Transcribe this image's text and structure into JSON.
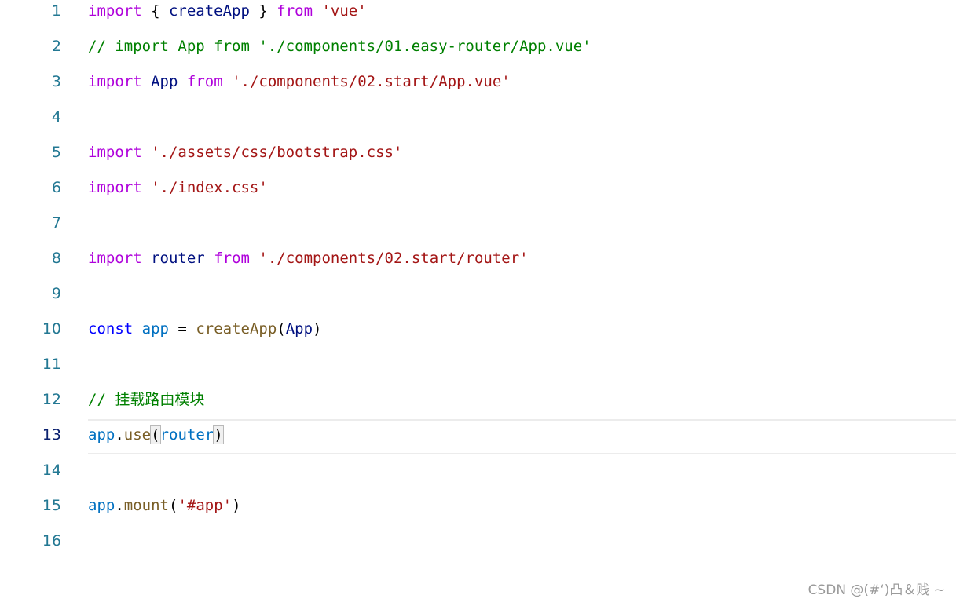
{
  "lines": [
    {
      "num": "1",
      "tokens": [
        {
          "t": "import",
          "c": "kw"
        },
        {
          "t": " { ",
          "c": "plain"
        },
        {
          "t": "createApp",
          "c": "var"
        },
        {
          "t": " } ",
          "c": "plain"
        },
        {
          "t": "from",
          "c": "kw"
        },
        {
          "t": " ",
          "c": "plain"
        },
        {
          "t": "'vue'",
          "c": "str"
        }
      ]
    },
    {
      "num": "2",
      "tokens": [
        {
          "t": "// import App from './components/01.easy-router/App.vue'",
          "c": "cm"
        }
      ]
    },
    {
      "num": "3",
      "tokens": [
        {
          "t": "import",
          "c": "kw"
        },
        {
          "t": " ",
          "c": "plain"
        },
        {
          "t": "App",
          "c": "var"
        },
        {
          "t": " ",
          "c": "plain"
        },
        {
          "t": "from",
          "c": "kw"
        },
        {
          "t": " ",
          "c": "plain"
        },
        {
          "t": "'./components/02.start/App.vue'",
          "c": "str"
        }
      ]
    },
    {
      "num": "4",
      "tokens": []
    },
    {
      "num": "5",
      "tokens": [
        {
          "t": "import",
          "c": "kw"
        },
        {
          "t": " ",
          "c": "plain"
        },
        {
          "t": "'./assets/css/bootstrap.css'",
          "c": "str"
        }
      ]
    },
    {
      "num": "6",
      "tokens": [
        {
          "t": "import",
          "c": "kw"
        },
        {
          "t": " ",
          "c": "plain"
        },
        {
          "t": "'./index.css'",
          "c": "str"
        }
      ]
    },
    {
      "num": "7",
      "tokens": []
    },
    {
      "num": "8",
      "tokens": [
        {
          "t": "import",
          "c": "kw"
        },
        {
          "t": " ",
          "c": "plain"
        },
        {
          "t": "router",
          "c": "var"
        },
        {
          "t": " ",
          "c": "plain"
        },
        {
          "t": "from",
          "c": "kw"
        },
        {
          "t": " ",
          "c": "plain"
        },
        {
          "t": "'./components/02.start/router'",
          "c": "str"
        }
      ]
    },
    {
      "num": "9",
      "tokens": []
    },
    {
      "num": "10",
      "tokens": [
        {
          "t": "const",
          "c": "const"
        },
        {
          "t": " ",
          "c": "plain"
        },
        {
          "t": "app",
          "c": "blue"
        },
        {
          "t": " = ",
          "c": "plain"
        },
        {
          "t": "createApp",
          "c": "fn"
        },
        {
          "t": "(",
          "c": "plain"
        },
        {
          "t": "App",
          "c": "var"
        },
        {
          "t": ")",
          "c": "plain"
        }
      ]
    },
    {
      "num": "11",
      "tokens": []
    },
    {
      "num": "12",
      "tokens": [
        {
          "t": "// 挂载路由模块",
          "c": "cm"
        }
      ]
    },
    {
      "num": "13",
      "tokens": [
        {
          "t": "app",
          "c": "blue"
        },
        {
          "t": ".",
          "c": "plain"
        },
        {
          "t": "use",
          "c": "fn"
        },
        {
          "t": "(",
          "c": "plain",
          "match": true
        },
        {
          "t": "router",
          "c": "blue"
        },
        {
          "t": ")",
          "c": "plain",
          "match": true
        }
      ]
    },
    {
      "num": "14",
      "tokens": []
    },
    {
      "num": "15",
      "tokens": [
        {
          "t": "app",
          "c": "blue"
        },
        {
          "t": ".",
          "c": "plain"
        },
        {
          "t": "mount",
          "c": "fn"
        },
        {
          "t": "(",
          "c": "plain"
        },
        {
          "t": "'#app'",
          "c": "str"
        },
        {
          "t": ")",
          "c": "plain"
        }
      ]
    },
    {
      "num": "16",
      "tokens": []
    }
  ],
  "active_line": "13",
  "watermark": "CSDN @(#‘)凸＆贱 ~",
  "colors": {
    "keyword": "#af00db",
    "string": "#a31515",
    "comment": "#008000",
    "line_number": "#237893"
  }
}
